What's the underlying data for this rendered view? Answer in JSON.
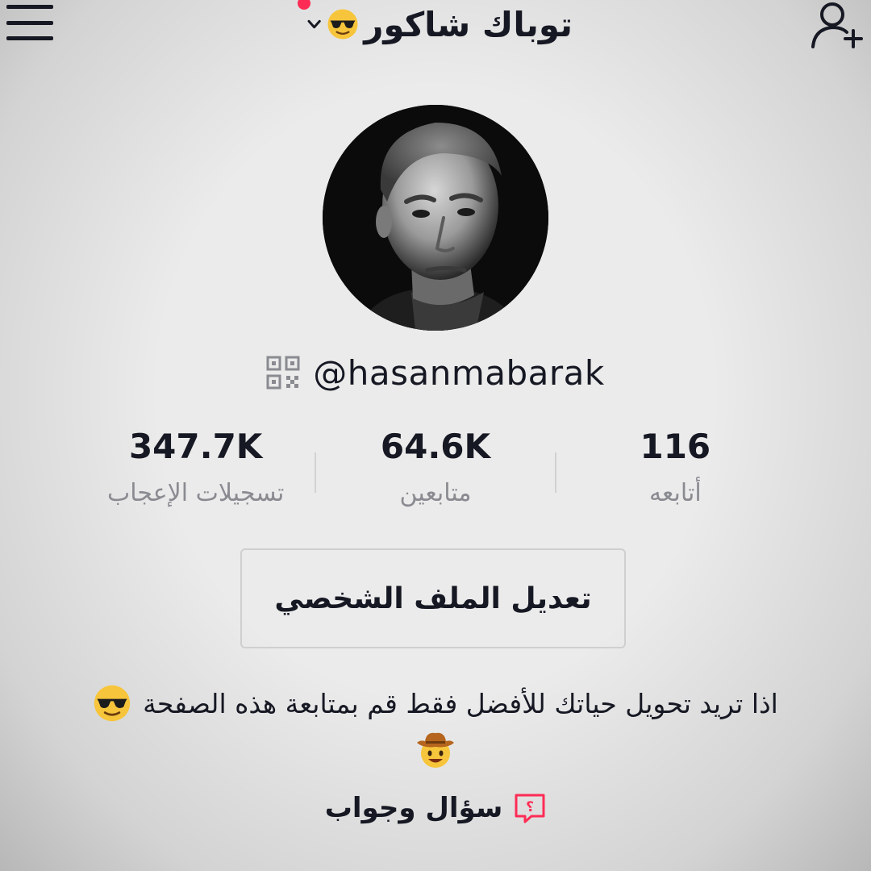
{
  "header": {
    "title": "توباك شاكور",
    "title_emoji": "sunglasses-emoji",
    "dropdown_icon": "chevron-down-icon",
    "menu_icon": "hamburger-menu-icon",
    "add_user_icon": "add-user-icon",
    "notification_dot_color": "#fe2c55"
  },
  "profile": {
    "username": "@hasanmabarak",
    "qr_icon": "qr-code-icon"
  },
  "stats": [
    {
      "value": "116",
      "label": "أتابعه"
    },
    {
      "value": "64.6K",
      "label": "متابعين"
    },
    {
      "value": "347.7K",
      "label": "تسجيلات الإعجاب"
    }
  ],
  "edit_button": {
    "label": "تعديل الملف الشخصي"
  },
  "bio": {
    "text": "اذا تريد تحويل حياتك للأفضل فقط قم بمتابعة هذه الصفحة",
    "emoji_1": "sunglasses-emoji",
    "emoji_2": "cowboy-emoji"
  },
  "qa": {
    "label": "سؤال وجواب",
    "icon": "question-bubble-icon",
    "accent_color": "#fe2c55"
  }
}
